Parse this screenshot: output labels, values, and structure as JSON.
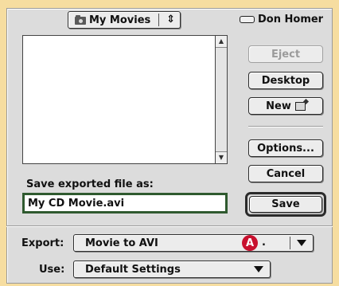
{
  "folder_popup": {
    "label": "My Movies",
    "icon": "folder-icon",
    "arrows": "⇕"
  },
  "drive": {
    "label": "Don Homer",
    "icon": "drive-icon"
  },
  "buttons": {
    "eject": "Eject",
    "desktop": "Desktop",
    "new": "New",
    "options": "Options...",
    "cancel": "Cancel",
    "save": "Save"
  },
  "save_as": {
    "label": "Save exported file as:",
    "value": "My CD Movie.avi"
  },
  "export": {
    "label": "Export:",
    "value": "Movie to AVI",
    "callout": "A",
    "callout_suffix": "."
  },
  "use": {
    "label": "Use:",
    "value": "Default Settings"
  },
  "colors": {
    "background": "#f6dda0",
    "callout": "#c8102e",
    "field_border": "#2f5a2f"
  }
}
